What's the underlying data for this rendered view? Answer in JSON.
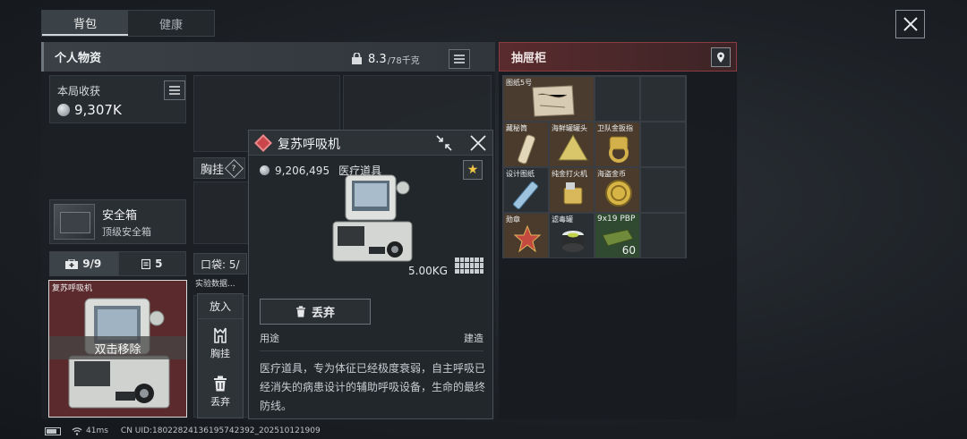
{
  "tabs": [
    {
      "label": "背包",
      "active": true
    },
    {
      "label": "健康",
      "active": false
    }
  ],
  "personal": {
    "title": "个人物资",
    "weight_current": "8.3",
    "weight_max": "/78千克"
  },
  "harvest": {
    "label": "本局收获",
    "value": "9,307K"
  },
  "safe_box": {
    "name": "安全箱",
    "level": "顶级安全箱"
  },
  "counters": {
    "box_count": "9/9",
    "other_count": "5"
  },
  "selected_item": {
    "name": "复苏呼吸机",
    "hint": "双击移除"
  },
  "slots": {
    "chest_label": "胸挂",
    "pocket_label": "口袋: 5/",
    "exp_label": "实验数据..."
  },
  "context_menu": {
    "place": "放入",
    "chest": "胸挂",
    "discard": "丢弃"
  },
  "detail": {
    "title": "复苏呼吸机",
    "price": "9,206,495",
    "category": "医疗道具",
    "weight": "5.00KG",
    "discard_label": "丢弃",
    "usage_label": "用途",
    "build_label": "建造",
    "description": "医疗道具，专为体征已经极度衰弱，自主呼吸已经消失的病患设计的辅助呼吸设备，生命的最终防线。",
    "accent": "#c9464a"
  },
  "cabinet": {
    "title": "抽屉柜",
    "items": [
      {
        "label": "图纸5号",
        "style": "map"
      },
      {
        "label": "",
        "style": ""
      },
      {
        "label": "",
        "style": ""
      },
      {
        "label": "藏秘筒",
        "style": "rare"
      },
      {
        "label": "海鲜罐罐头",
        "style": "rare"
      },
      {
        "label": "卫队金扳指",
        "style": "rare"
      },
      {
        "label": "",
        "style": ""
      },
      {
        "label": "设计图纸",
        "style": ""
      },
      {
        "label": "纯金打火机",
        "style": "rare"
      },
      {
        "label": "海盗金币",
        "style": "rare"
      },
      {
        "label": "",
        "style": ""
      },
      {
        "label": "勋章",
        "style": "rare"
      },
      {
        "label": "滤毒罐",
        "style": ""
      },
      {
        "label": "9x19 PBP",
        "style": "green",
        "qty": "60"
      },
      {
        "label": "",
        "style": ""
      }
    ]
  },
  "footer": {
    "ping": "41ms",
    "uid": "CN UID:1802282413619574239​2_202510121909"
  }
}
